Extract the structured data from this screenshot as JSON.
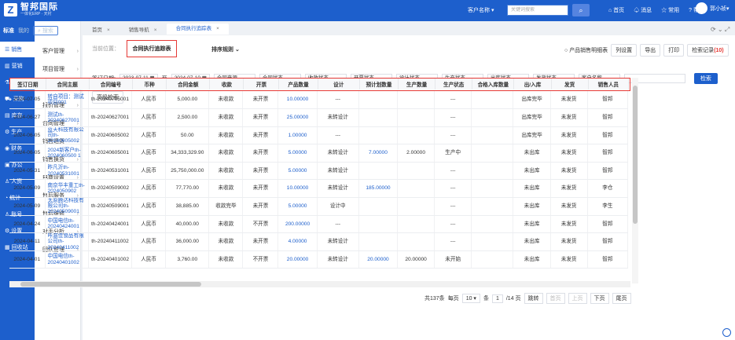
{
  "brand": {
    "logo_letter": "Z",
    "name": "智邦国际",
    "tagline": "一体化ERP · 天村"
  },
  "topbar": {
    "customer_select": "客户名称",
    "search_placeholder": "关键词搜索",
    "links": [
      "首页",
      "消息",
      "常用",
      "帮助"
    ],
    "user": "郭小祯"
  },
  "sidebar": {
    "head": {
      "label": "标准",
      "mine": "我的",
      "search": "搜索"
    },
    "nav": [
      "销售",
      "营销",
      "研发",
      "采购",
      "库存",
      "生产",
      "财务",
      "办公",
      "人资",
      "统计",
      "账号",
      "设置",
      "回收站"
    ],
    "active": "销售",
    "sub": [
      "客户管理",
      "项目管理",
      "投标管理",
      "报价管理",
      "合同管理",
      "销售退货",
      "销售换货",
      "电商设置",
      "售后服务",
      "售后维修",
      "对手分析",
      "团队管理"
    ]
  },
  "tabs": [
    {
      "label": "首页"
    },
    {
      "label": "销售导航"
    },
    {
      "label": "合同执行追踪表"
    }
  ],
  "page": {
    "crumb_prefix": "当前位置：",
    "crumb": "合同执行追踪表",
    "sort_rule": "排序规则",
    "product_detail": "产品销售明细表",
    "actions": [
      "列设置",
      "导出",
      "打印"
    ],
    "check_record": "检索记录",
    "check_count": "(10)"
  },
  "filters": {
    "date_label": "签订日期:",
    "date_from": "2023-07-11",
    "date_sep": "至",
    "date_to": "2024-07-10",
    "selects": [
      "合同来源",
      "合同状态",
      "收款状态",
      "开票状态",
      "设计状态",
      "生产状态",
      "出库状态",
      "发货状态",
      "客户名称"
    ],
    "query": "检索",
    "advanced": "高级检索"
  },
  "table": {
    "headers": [
      "签订日期",
      "合同主题",
      "合同编号",
      "币种",
      "合同金额",
      "收款",
      "开票",
      "产品数量",
      "设计",
      "预计划数量",
      "生产数量",
      "生产状态",
      "合格入库数量",
      "出/入库",
      "发货",
      "销售人员"
    ],
    "rows": [
      [
        "2024-07-05",
        "转自项目：测试项目001",
        "th-20240705001",
        "人民币",
        "5,000.00",
        "未收款",
        "未开票",
        "10.00000",
        "---",
        "",
        "",
        "---",
        "",
        "出库完毕",
        "未发货",
        "智邦"
      ],
      [
        "2024-06-27",
        "测试th-20240627001",
        "th-20240627001",
        "人民币",
        "2,500.00",
        "未收款",
        "未开票",
        "25.00000",
        "未转设计",
        "",
        "",
        "---",
        "",
        "出库完毕",
        "未发货",
        "智邦"
      ],
      [
        "2024-06-05",
        "蓝天科技有限公司th-20240605002",
        "th-20240605002",
        "人民币",
        "50.00",
        "未收款",
        "未开票",
        "1.00000",
        "---",
        "",
        "",
        "---",
        "",
        "出库完毕",
        "未发货",
        "智邦"
      ],
      [
        "2024-06-05",
        "2024新客户th-2024060500 1",
        "th-20240605001",
        "人民币",
        "34,333,329.90",
        "未收款",
        "未开票",
        "5.00000",
        "未转设计",
        "7.00000",
        "2.00000",
        "生产中",
        "",
        "未出库",
        "未发货",
        "智邦"
      ],
      [
        "2024-05-31",
        "昨凡沂th-20240531001",
        "th-20240531001",
        "人民币",
        "25,750,000.00",
        "未收款",
        "未开票",
        "5.00000",
        "未转设计",
        "",
        "",
        "---",
        "",
        "未出库",
        "未发货",
        "智邦"
      ],
      [
        "2024-05-09",
        "南京华丰重工th-2024050902",
        "th-20240509002",
        "人民币",
        "77,770.00",
        "未收款",
        "未开票",
        "10.00000",
        "未转设计",
        "185.00000",
        "",
        "---",
        "",
        "未出库",
        "未发货",
        "李仓"
      ],
      [
        "2024-05-09",
        "太原腾达科技有限公司th-20240509001",
        "th-20240509001",
        "人民币",
        "38,885.00",
        "收款完毕",
        "未开票",
        "5.00000",
        "设计中",
        "",
        "",
        "---",
        "",
        "未出库",
        "未发货",
        "李生"
      ],
      [
        "2024-04-24",
        "中国电信th-20240424001",
        "th-20240424001",
        "人民币",
        "40,000.00",
        "未收款",
        "不开票",
        "200.00000",
        "---",
        "",
        "",
        "---",
        "",
        "未出库",
        "未发货",
        "智邦"
      ],
      [
        "2024-04-11",
        "咔滋佳食品有限公司th-20240411002",
        "th-20240411002",
        "人民币",
        "36,000.00",
        "未收款",
        "未开票",
        "4.00000",
        "未转设计",
        "",
        "",
        "---",
        "",
        "未出库",
        "未发货",
        "智邦"
      ],
      [
        "2024-04-01",
        "中国电信th-20240401002",
        "th-20240401002",
        "人民币",
        "3,760.00",
        "未收款",
        "不开票",
        "20.00000",
        "未转设计",
        "20.00000",
        "20.00000",
        "未开始",
        "",
        "未出库",
        "未发货",
        "智邦"
      ]
    ]
  },
  "pager": {
    "total": "共137条",
    "per_page_label": "每页",
    "per_page": "10",
    "unit": "条",
    "page": "1",
    "pages": "/14 页",
    "jump": "跳转",
    "first": "首页",
    "prev": "上页",
    "next": "下页",
    "last": "尾页"
  }
}
